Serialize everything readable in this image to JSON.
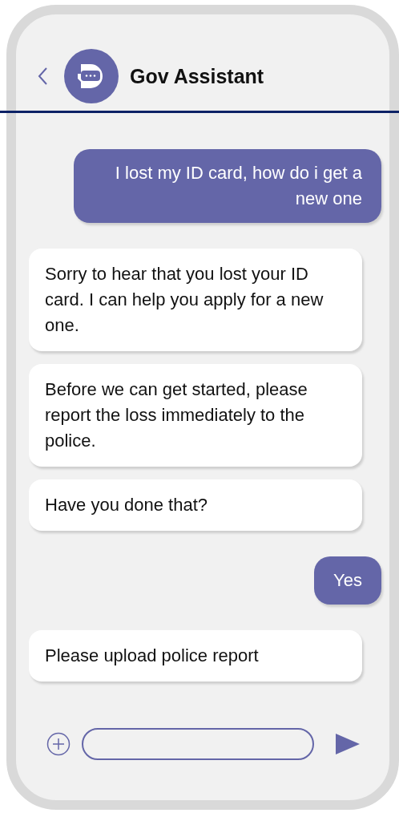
{
  "header": {
    "title": "Gov Assistant"
  },
  "messages": [
    {
      "kind": "user",
      "text": "I lost my ID card, how do i get a new one"
    },
    {
      "kind": "bot",
      "text": "Sorry to hear that you lost your ID card. I can help you apply for a new one."
    },
    {
      "kind": "bot",
      "text": "Before we can get started, please report the loss immediately to the police."
    },
    {
      "kind": "bot",
      "text": "Have you done that?"
    },
    {
      "kind": "user",
      "text": "Yes"
    },
    {
      "kind": "bot",
      "text": "Please upload police report"
    }
  ]
}
